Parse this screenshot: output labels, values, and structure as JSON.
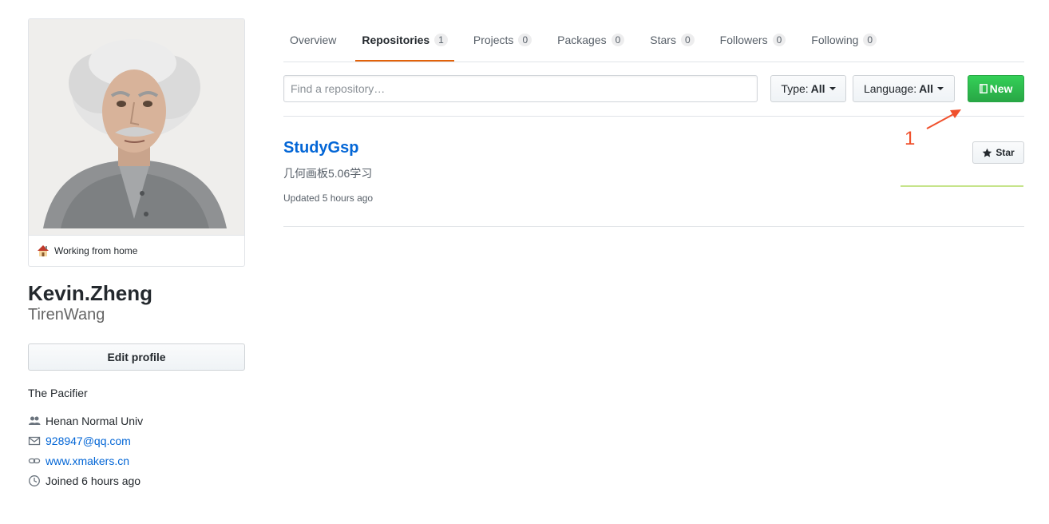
{
  "sidebar": {
    "status_text": "Working from home",
    "full_name": "Kevin.Zheng",
    "username": "TirenWang",
    "edit_profile_label": "Edit profile",
    "bio": "The Pacifier",
    "details": {
      "organization": "Henan Normal Univ",
      "email": "928947@qq.com",
      "website": "www.xmakers.cn",
      "joined": "Joined 6 hours ago"
    }
  },
  "tabs": [
    {
      "label": "Overview",
      "count": null
    },
    {
      "label": "Repositories",
      "count": "1"
    },
    {
      "label": "Projects",
      "count": "0"
    },
    {
      "label": "Packages",
      "count": "0"
    },
    {
      "label": "Stars",
      "count": "0"
    },
    {
      "label": "Followers",
      "count": "0"
    },
    {
      "label": "Following",
      "count": "0"
    }
  ],
  "filters": {
    "search_placeholder": "Find a repository…",
    "type_label": "Type:",
    "type_value": "All",
    "language_label": "Language:",
    "language_value": "All",
    "new_label": "New"
  },
  "repo": {
    "name": "StudyGsp",
    "description": "几何画板5.06学习",
    "updated": "Updated 5 hours ago",
    "star_label": "Star"
  },
  "annotation": {
    "number": "1",
    "color": "#f0502c"
  },
  "colors": {
    "link": "#0366d6",
    "tab_underline": "#e36209",
    "new_button": "#28a745"
  }
}
